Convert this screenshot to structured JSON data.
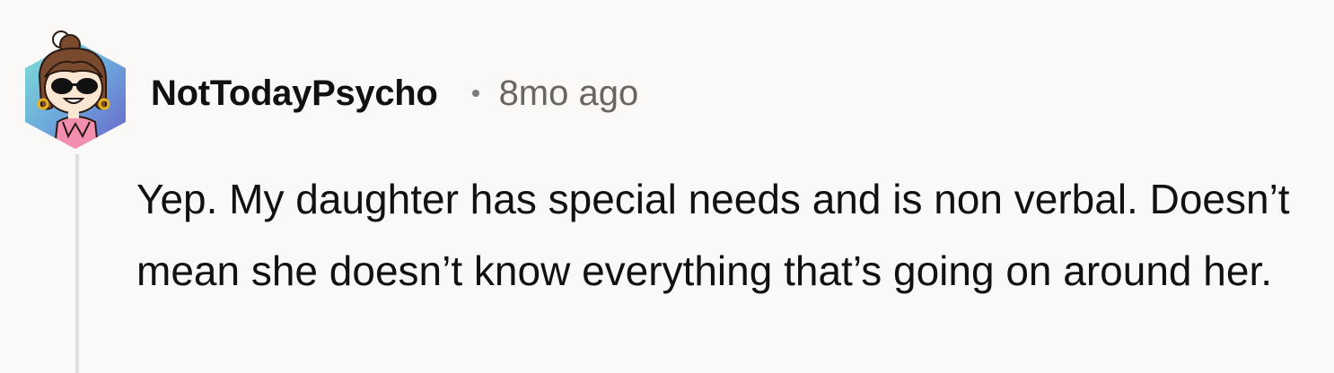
{
  "comment": {
    "username": "NotTodayPsycho",
    "separator": "•",
    "time": "8mo ago",
    "body": "Yep. My daughter has special needs and is non verbal. Doesn’t mean she doesn’t know everything that’s going on around her."
  }
}
